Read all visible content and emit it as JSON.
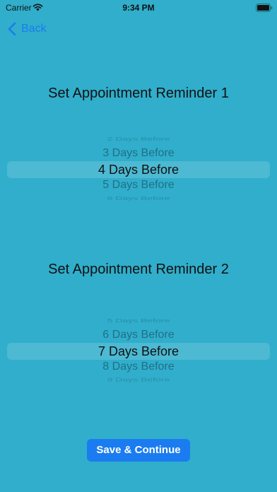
{
  "status_bar": {
    "carrier": "Carrier",
    "time": "9:34 PM",
    "wifi_icon": "wifi-icon",
    "battery_icon": "battery-icon"
  },
  "nav": {
    "back_label": "Back",
    "back_icon": "chevron-left-icon",
    "accent_color": "#1a7cf0"
  },
  "reminder1": {
    "title": "Set Appointment Reminder 1",
    "rows": [
      "2 Days Before",
      "3 Days Before",
      "4 Days Before",
      "5 Days Before",
      "6 Days Before"
    ],
    "selected": "4 Days Before"
  },
  "reminder2": {
    "title": "Set Appointment Reminder 2",
    "rows": [
      "5 Days Before",
      "6 Days Before",
      "7 Days Before",
      "8 Days Before",
      "9 Days Before"
    ],
    "selected": "7 Days Before"
  },
  "actions": {
    "save_label": "Save & Continue"
  },
  "colors": {
    "background": "#30aecb",
    "button": "#1a7cf0",
    "button_text": "#ffffff"
  }
}
